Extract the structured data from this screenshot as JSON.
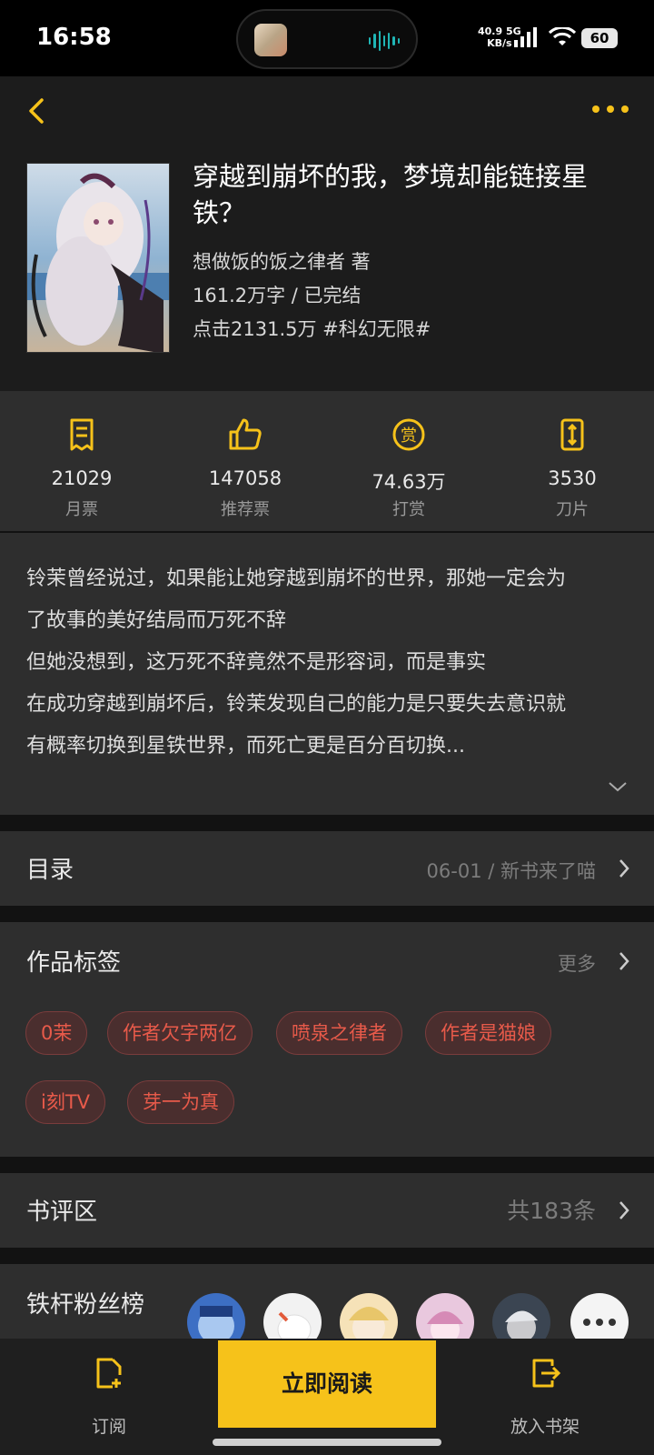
{
  "status_bar": {
    "time": "16:58",
    "net_speed_value": "40.9",
    "net_speed_unit": "KB/s",
    "net_type": "5G",
    "battery": "60"
  },
  "book": {
    "title": "穿越到崩坏的我，梦境却能链接星铁？",
    "author_line": "想做饭的饭之律者  著",
    "meta_line": "161.2万字 / 已完结",
    "clicks_line": "点击2131.5万  #科幻无限#"
  },
  "stats": [
    {
      "value": "21029",
      "label": "月票",
      "icon": "ticket-icon"
    },
    {
      "value": "147058",
      "label": "推荐票",
      "icon": "thumbs-up-icon"
    },
    {
      "value": "74.63万",
      "label": "打赏",
      "icon": "reward-icon"
    },
    {
      "value": "3530",
      "label": "刀片",
      "icon": "blade-icon"
    }
  ],
  "synopsis": {
    "lines": [
      "铃茉曾经说过，如果能让她穿越到崩坏的世界，那她一定会为",
      "了故事的美好结局而万死不辞",
      "但她没想到，这万死不辞竟然不是形容词，而是事实",
      "在成功穿越到崩坏后，铃茉发现自己的能力是只要失去意识就",
      "有概率切换到星铁世界，而死亡更是百分百切换..."
    ]
  },
  "toc": {
    "title": "目录",
    "latest": "06-01 / 新书来了喵"
  },
  "tags": {
    "title": "作品标签",
    "more": "更多",
    "items": [
      "0茉",
      "作者欠字两亿",
      "喷泉之律者",
      "作者是猫娘",
      "i刻TV",
      "芽一为真"
    ]
  },
  "reviews": {
    "title": "书评区",
    "count": "共183条"
  },
  "fans": {
    "title": "铁杆粉丝榜"
  },
  "bottom": {
    "subscribe": "订阅",
    "read_now": "立即阅读",
    "add_shelf": "放入书架"
  },
  "colors": {
    "accent": "#f6c21a",
    "tag_text": "#e85a4a"
  }
}
